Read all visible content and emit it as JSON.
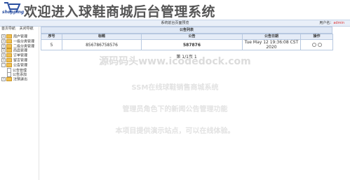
{
  "header": {
    "logo_text": "shopping",
    "title": "欢迎进入球鞋商城后台管理系统"
  },
  "statusbar": {
    "center_text": "系统前台页面预览",
    "user_label": "用户名：",
    "user_name": "admin"
  },
  "sidebar": {
    "top_links": [
      "首页导航",
      "关闭导航"
    ],
    "items": [
      {
        "label": "用户管理",
        "type": "folder",
        "expand": "+"
      },
      {
        "label": "一级分类管理",
        "type": "folder",
        "expand": "+"
      },
      {
        "label": "二级分类管理",
        "type": "folder",
        "expand": "+"
      },
      {
        "label": "商品管理",
        "type": "folder",
        "expand": "+"
      },
      {
        "label": "订单管理",
        "type": "folder",
        "expand": "+"
      },
      {
        "label": "留言管理",
        "type": "folder",
        "expand": "+"
      },
      {
        "label": "公告管理",
        "type": "folder",
        "expand": "-"
      },
      {
        "label": "公告管理",
        "type": "doc",
        "child": true
      },
      {
        "label": "公告添加",
        "type": "doc",
        "child": true
      },
      {
        "label": "注销退出",
        "type": "folder",
        "expand": "+"
      }
    ]
  },
  "table": {
    "title": "公告列表",
    "columns": [
      "序号",
      "标题",
      "公告",
      "公告日期",
      "操作"
    ],
    "rows": [
      {
        "index": "5",
        "title": "856786758576",
        "content": "587876",
        "date": "Tue May 12 19:36:08 CST 2020"
      }
    ],
    "pager": "第 1/1页 1"
  },
  "watermark": {
    "line1": "源码码头www.icodedock.com",
    "line2": "SSM在线球鞋销售商城系统",
    "line3": "管理员角色下的新闻公告管理功能",
    "line4": "本项目提供演示站点，可以在线体验。"
  },
  "colors": {
    "accent": "#b7c8e0",
    "title_red": "#c0392b",
    "user_red": "#dd3333"
  }
}
